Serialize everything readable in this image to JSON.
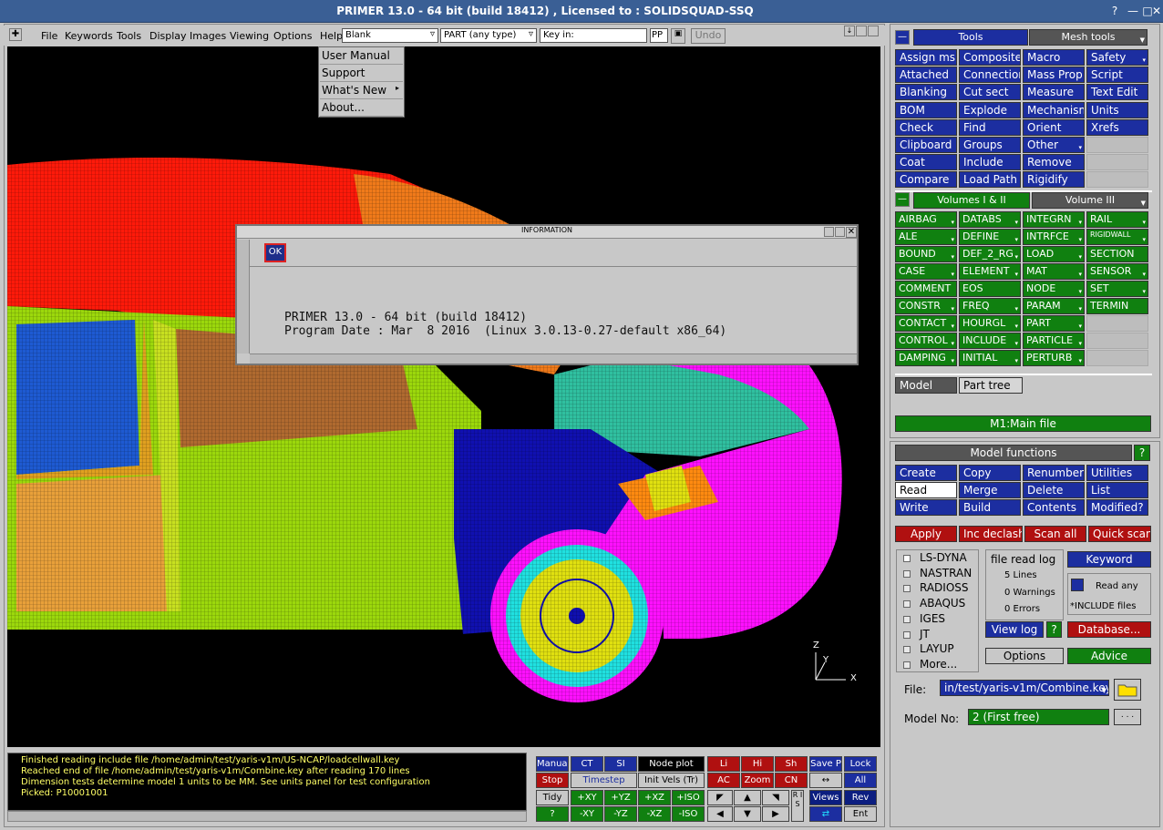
{
  "window": {
    "title": "PRIMER 13.0 - 64 bit (build 18412) , Licensed to : SOLIDSQUAD-SSQ"
  },
  "menubar": {
    "items": [
      "File",
      "Keywords",
      "Tools",
      "Display",
      "Images",
      "Viewing",
      "Options",
      "Help"
    ],
    "blank_select": "Blank",
    "part_select": "PART (any type)",
    "key_in": "Key in:",
    "pp": "PP",
    "undo": "Undo"
  },
  "help_menu": {
    "items": [
      "User Manual",
      "Support",
      "What's New",
      "About..."
    ]
  },
  "info": {
    "title": "INFORMATION",
    "ok": "OK",
    "line1": "PRIMER 13.0 - 64 bit (build 18412)",
    "line2": "Program Date : Mar  8 2016  (Linux 3.0.13-0.27-default x86_64)"
  },
  "axes": {
    "z": "Z",
    "y": "Y",
    "x": "X"
  },
  "console": {
    "lines": [
      "Finished reading include file /home/admin/test/yaris-v1m/US-NCAP/loadcellwall.key",
      "Reached end of file /home/admin/test/yaris-v1m/Combine.key after reading 170 lines",
      "Dimension tests determine model 1 units to be MM. See units panel for test configuration",
      "Picked: P10001001"
    ]
  },
  "bottom_toolbar": {
    "manual": "Manual",
    "stop": "Stop",
    "tidy": "Tidy",
    "q": "?",
    "ct": "CT",
    "si": "SI",
    "timestep": "Timestep",
    "xy": "+XY",
    "yz": "+YZ",
    "xz": "+XZ",
    "iso": "+ISO",
    "nxy": "-XY",
    "nyz": "-YZ",
    "nxz": "-XZ",
    "niso": "-ISO",
    "node_plot": "Node plot",
    "init_vels": "Init Vels (Tr)",
    "li": "Li",
    "hi": "Hi",
    "sh": "Sh",
    "ac": "AC",
    "zoom": "Zoom",
    "cn": "CN",
    "save_p": "Save P",
    "lock": "Lock",
    "all": "All",
    "views": "Views",
    "rev": "Rev",
    "ent": "Ent",
    "ris": "R I S"
  },
  "tools_panel": {
    "tab_tools": "Tools",
    "tab_mesh": "Mesh tools",
    "buttons": [
      [
        "Assign ms",
        "Composite",
        "Macro",
        "Safety"
      ],
      [
        "Attached",
        "Connection",
        "Mass Prop",
        "Script"
      ],
      [
        "Blanking",
        "Cut sect",
        "Measure",
        "Text Edit"
      ],
      [
        "BOM",
        "Explode",
        "Mechanism",
        "Units"
      ],
      [
        "Check",
        "Find",
        "Orient",
        "Xrefs"
      ],
      [
        "Clipboard",
        "Groups",
        "Other",
        ""
      ],
      [
        "Coat",
        "Include",
        "Remove",
        ""
      ],
      [
        "Compare",
        "Load Path",
        "Rigidify",
        ""
      ]
    ]
  },
  "keyword_panel": {
    "tab_vol12": "Volumes I & II",
    "tab_vol3": "Volume III",
    "buttons": [
      [
        "AIRBAG",
        "DATABS",
        "INTEGRN",
        "RAIL"
      ],
      [
        "ALE",
        "DEFINE",
        "INTRFCE",
        "RIGIDWALL"
      ],
      [
        "BOUND",
        "DEF_2_RG",
        "LOAD",
        "SECTION"
      ],
      [
        "CASE",
        "ELEMENT",
        "MAT",
        "SENSOR"
      ],
      [
        "COMMENT",
        "EOS",
        "NODE",
        "SET"
      ],
      [
        "CONSTR",
        "FREQ",
        "PARAM",
        "TERMIN"
      ],
      [
        "CONTACT",
        "HOURGL",
        "PART",
        ""
      ],
      [
        "CONTROL",
        "INCLUDE",
        "PARTICLE",
        ""
      ],
      [
        "DAMPING",
        "INITIAL",
        "PERTURB",
        ""
      ]
    ]
  },
  "model_tabs": {
    "model": "Model",
    "part_tree": "Part tree",
    "main_file": "M1:Main file"
  },
  "model_functions": {
    "title": "Model functions",
    "help": "?",
    "buttons": [
      [
        "Create",
        "Copy",
        "Renumber",
        "Utilities"
      ],
      [
        "Read",
        "Merge",
        "Delete",
        "List"
      ],
      [
        "Write",
        "Build",
        "Contents",
        "Modified?"
      ]
    ],
    "apply": "Apply",
    "inc_declash": "Inc declash",
    "scan_all": "Scan all",
    "quick_scan": "Quick scan",
    "formats": [
      "LS-DYNA",
      "NASTRAN",
      "RADIOSS",
      "ABAQUS",
      "IGES",
      "JT",
      "LAYUP",
      "More..."
    ],
    "file_read_log": "file read log",
    "lines": "5 Lines",
    "warnings": "0 Warnings",
    "errors": "0 Errors",
    "view_log": "View log",
    "keyword": "Keyword",
    "read_any": "Read any",
    "include_files": "*INCLUDE files",
    "database": "Database...",
    "options": "Options",
    "advice": "Advice",
    "file_label": "File:",
    "file_value": "in/test/yaris-v1m/Combine.key",
    "model_no_label": "Model No:",
    "model_no_value": "2 (First free)",
    "dots": ". . ."
  }
}
